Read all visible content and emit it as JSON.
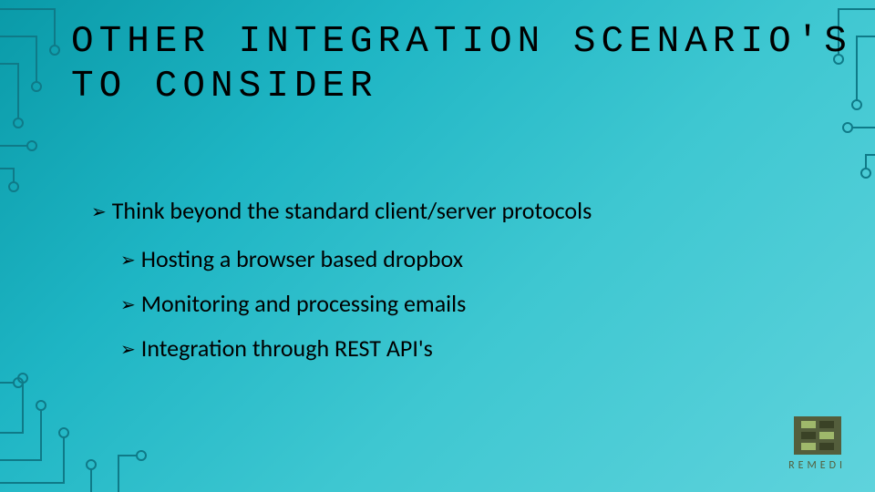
{
  "title": "OTHER INTEGRATION SCENARIO'S TO CONSIDER",
  "bullets": {
    "main": "Think beyond the standard client/server protocols",
    "sub": [
      "Hosting a browser based dropbox",
      "Monitoring and processing emails",
      "Integration through REST API's"
    ]
  },
  "logo": {
    "text": "REMEDI"
  }
}
